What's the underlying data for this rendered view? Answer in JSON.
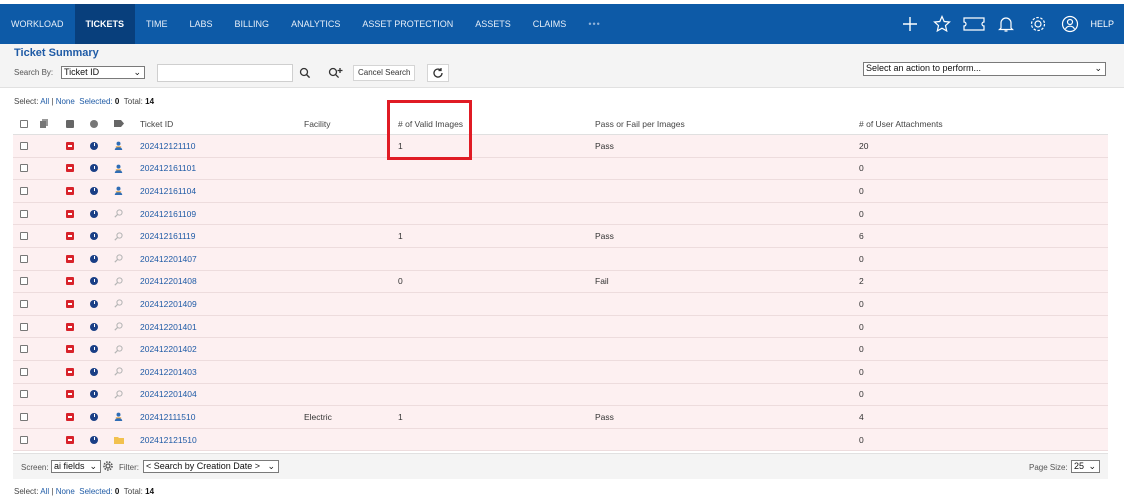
{
  "nav": {
    "items": [
      "WORKLOAD",
      "TICKETS",
      "TIME",
      "LABS",
      "BILLING",
      "ANALYTICS",
      "ASSET PROTECTION",
      "ASSETS",
      "CLAIMS"
    ],
    "active": "TICKETS",
    "more": "•••",
    "help": "HELP",
    "icons": [
      "plus-icon",
      "star-icon",
      "ticket-icon",
      "bell-icon",
      "gear-icon",
      "user-circle-icon"
    ]
  },
  "summary": {
    "title": "Ticket Summary",
    "search_by_label": "Search By:",
    "search_by_value": "Ticket ID",
    "cancel_label": "Cancel Search",
    "action_placeholder": "Select an action to perform..."
  },
  "selection": {
    "select_label": "Select:",
    "all": "All",
    "sep": "|",
    "none": "None",
    "selected_label": "Selected:",
    "selected_count": "0",
    "total_label": "Total:",
    "total_count": "14"
  },
  "table": {
    "headers": [
      "Ticket ID",
      "Facility",
      "# of Valid Images",
      "Pass or Fail per Images",
      "# of User Attachments"
    ],
    "rows": [
      {
        "id": "202412121110",
        "type": "person",
        "facility": "",
        "valid": "1",
        "pf": "Pass",
        "att": "20"
      },
      {
        "id": "202412161101",
        "type": "person",
        "facility": "",
        "valid": "",
        "pf": "",
        "att": "0"
      },
      {
        "id": "202412161104",
        "type": "person",
        "facility": "",
        "valid": "",
        "pf": "",
        "att": "0"
      },
      {
        "id": "202412161109",
        "type": "search",
        "facility": "",
        "valid": "",
        "pf": "",
        "att": "0"
      },
      {
        "id": "202412161119",
        "type": "search",
        "facility": "",
        "valid": "1",
        "pf": "Pass",
        "att": "6"
      },
      {
        "id": "202412201407",
        "type": "search",
        "facility": "",
        "valid": "",
        "pf": "",
        "att": "0"
      },
      {
        "id": "202412201408",
        "type": "search",
        "facility": "",
        "valid": "0",
        "pf": "Fail",
        "att": "2"
      },
      {
        "id": "202412201409",
        "type": "search",
        "facility": "",
        "valid": "",
        "pf": "",
        "att": "0"
      },
      {
        "id": "202412201401",
        "type": "search",
        "facility": "",
        "valid": "",
        "pf": "",
        "att": "0"
      },
      {
        "id": "202412201402",
        "type": "search",
        "facility": "",
        "valid": "",
        "pf": "",
        "att": "0"
      },
      {
        "id": "202412201403",
        "type": "search",
        "facility": "",
        "valid": "",
        "pf": "",
        "att": "0"
      },
      {
        "id": "202412201404",
        "type": "search",
        "facility": "",
        "valid": "",
        "pf": "",
        "att": "0"
      },
      {
        "id": "202412111510",
        "type": "person",
        "facility": "Electric",
        "valid": "1",
        "pf": "Pass",
        "att": "4"
      },
      {
        "id": "202412121510",
        "type": "folder",
        "facility": "",
        "valid": "",
        "pf": "",
        "att": "0"
      }
    ]
  },
  "footer": {
    "screen_label": "Screen:",
    "screen_value": "ai fields",
    "filter_label": "Filter:",
    "filter_value": "< Search by Creation Date >",
    "page_size_label": "Page Size:",
    "page_size_value": "25"
  },
  "colors": {
    "nav_bg": "#0d5aa7",
    "row_bg": "#fdf0f1",
    "link": "#1f5ba6",
    "highlight": "#e01b24"
  }
}
